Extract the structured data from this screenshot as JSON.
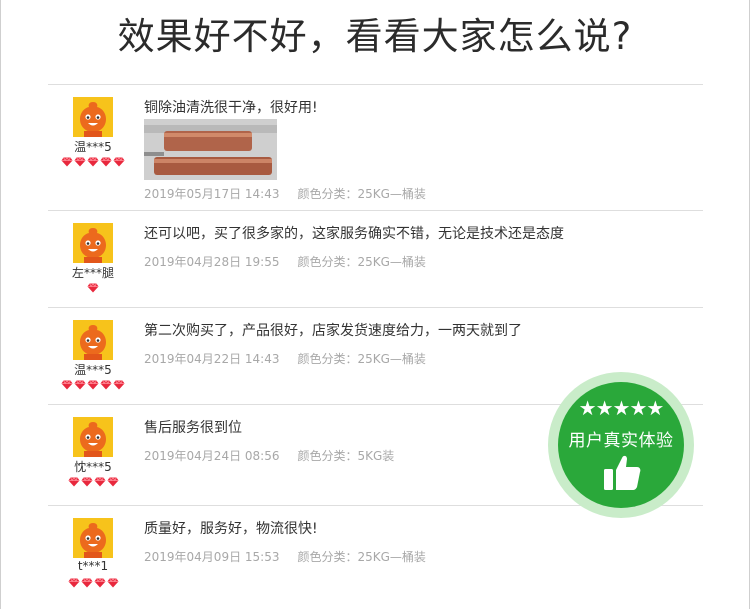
{
  "heading": "效果好不好，看看大家怎么说?",
  "reviews": [
    {
      "user": "温***5",
      "level": 5,
      "comment": "铜除油清洗很干净，很好用!",
      "has_photo": true,
      "date": "2019年05月17日 14:43",
      "spec": "颜色分类：25KG—桶装"
    },
    {
      "user": "左***腿",
      "level": 1,
      "comment": "还可以吧，买了很多家的，这家服务确实不错，无论是技术还是态度",
      "has_photo": false,
      "date": "2019年04月28日 19:55",
      "spec": "颜色分类：25KG—桶装"
    },
    {
      "user": "温***5",
      "level": 5,
      "comment": "第二次购买了，产品很好，店家发货速度给力，一两天就到了",
      "has_photo": false,
      "date": "2019年04月22日 14:43",
      "spec": "颜色分类：25KG—桶装"
    },
    {
      "user": "忱***5",
      "level": 4,
      "comment": "售后服务很到位",
      "has_photo": false,
      "date": "2019年04月24日 08:56",
      "spec": "颜色分类：5KG装"
    },
    {
      "user": "t***1",
      "level": 4,
      "comment": "质量好，服务好，物流很快!",
      "has_photo": false,
      "date": "2019年04月09日 15:53",
      "spec": "颜色分类：25KG—桶装"
    }
  ],
  "badge": {
    "stars": "★★★★★",
    "text": "用户真实体验",
    "icon": "thumbs-up-icon",
    "color": "#2aa83a"
  },
  "colors": {
    "avatar_bg": "#f7c31b",
    "avatar_face": "#ec6a1d",
    "gem": "#e8283d",
    "meta_text": "#a8a8a8"
  }
}
